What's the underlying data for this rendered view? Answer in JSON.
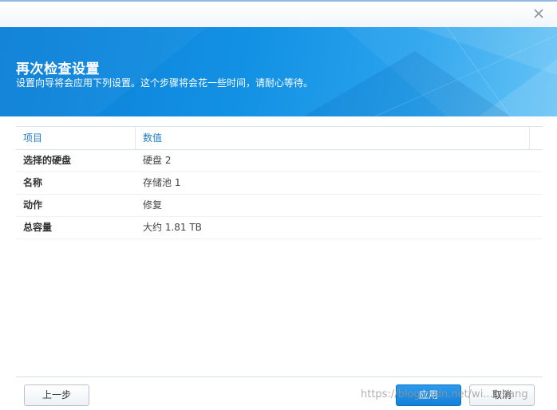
{
  "window": {
    "close_icon": "close-icon"
  },
  "banner": {
    "title": "再次检查设置",
    "subtitle": "设置向导将会应用下列设置。这个步骤将会花一些时间，请耐心等待。"
  },
  "table": {
    "headers": [
      "项目",
      "数值"
    ],
    "rows": [
      {
        "key": "选择的硬盘",
        "value": "硬盘 2"
      },
      {
        "key": "名称",
        "value": "存储池 1"
      },
      {
        "key": "动作",
        "value": "修复"
      },
      {
        "key": "总容量",
        "value": "大约 1.81 TB"
      }
    ]
  },
  "footer": {
    "prev_label": "上一步",
    "apply_label": "应用",
    "cancel_label": "取消"
  },
  "watermark": "https://blog.csdn.net/wi.../zhang",
  "colors": {
    "accent": "#1580d8",
    "header_text": "#1f7dc4",
    "banner_blue": "#0a7fd6"
  }
}
